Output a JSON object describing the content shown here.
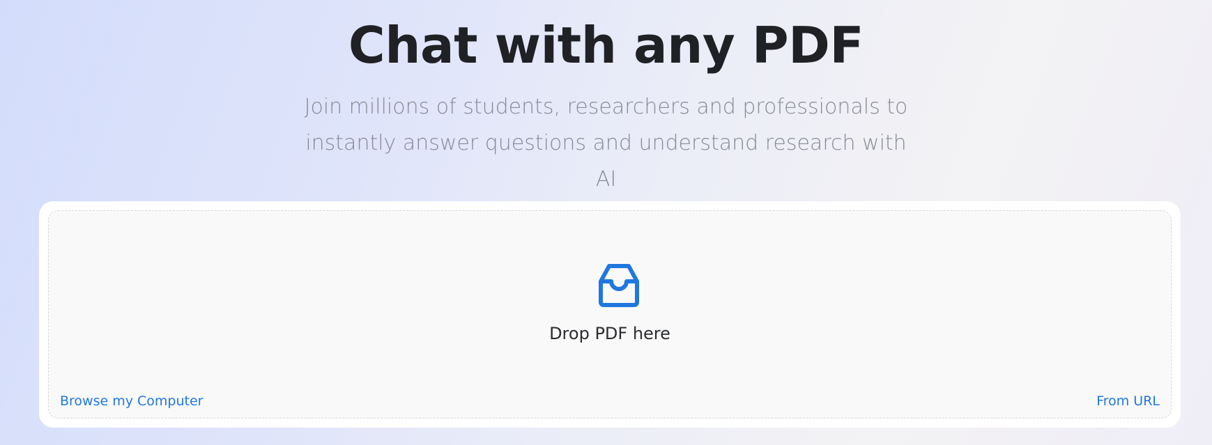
{
  "hero": {
    "title": "Chat with any PDF",
    "subtitle_line1": "Join millions of students, researchers and professionals to",
    "subtitle_line2": "instantly answer questions and understand research with AI"
  },
  "upload": {
    "icon": "inbox-icon",
    "drop_label": "Drop PDF here",
    "browse_label": "Browse my Computer",
    "url_label": "From URL"
  },
  "colors": {
    "accent": "#1f77e0",
    "title": "#1f2125",
    "subtitle": "#878b96"
  }
}
